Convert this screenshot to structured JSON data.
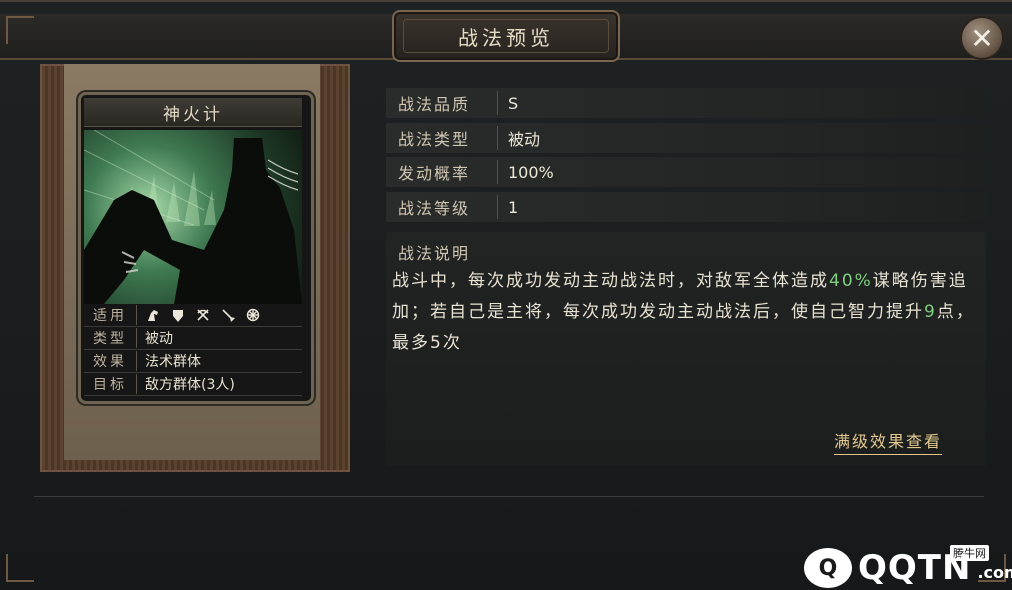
{
  "window": {
    "title": "战法预览",
    "close_label": "✕"
  },
  "card": {
    "name": "神火计",
    "attributes": [
      {
        "key": "适用",
        "icons": [
          "horse-icon",
          "shield-icon",
          "crossbow-icon",
          "spear-icon",
          "wheel-icon"
        ]
      },
      {
        "key": "类型",
        "value": "被动"
      },
      {
        "key": "效果",
        "value": "法术群体"
      },
      {
        "key": "目标",
        "value": "敌方群体(3人)"
      }
    ]
  },
  "info": {
    "rows": [
      {
        "key": "战法品质",
        "value": "S"
      },
      {
        "key": "战法类型",
        "value": "被动"
      },
      {
        "key": "发动概率",
        "value": "100%"
      },
      {
        "key": "战法等级",
        "value": "1"
      }
    ],
    "desc_title": "战法说明",
    "desc_segments": [
      {
        "text": "战斗中，每次成功发动主动战法时，对敌军全体造成",
        "highlight": false
      },
      {
        "text": "40%",
        "highlight": true
      },
      {
        "text": "谋略伤害追加；若自己是主将，每次成功发动主动战法后，使自己智力提升",
        "highlight": false
      },
      {
        "text": "9",
        "highlight": true
      },
      {
        "text": "点，最多5次",
        "highlight": false
      }
    ],
    "max_level_link": "满级效果查看"
  },
  "colors": {
    "highlight": "#7ecf7e",
    "link": "#e2c88e"
  },
  "watermark": {
    "cn": "腾牛网",
    "badge": "Q",
    "text": "QQTN",
    "suffix": ".com"
  }
}
